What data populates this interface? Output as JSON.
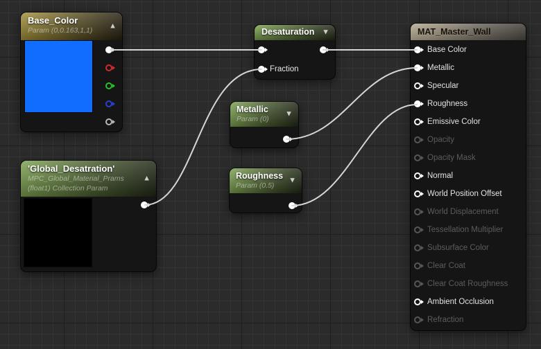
{
  "icons": {
    "collapse_up": "▲",
    "collapse_down": "▼"
  },
  "colors": {
    "background": "#2b2b2b",
    "grid_minor": "#343434",
    "grid_major": "#1f1f1f",
    "node_body": "#151515",
    "wire": "#d6d6d6",
    "header_gold": "#a3913a",
    "header_green": "#7da351",
    "header_tan": "#b7ac94",
    "base_color_swatch": "#0f6dff",
    "global_swatch": "#000000",
    "pin_red": "#d42a2a",
    "pin_green": "#2bbf2b",
    "pin_blue": "#2b3fd4",
    "pin_alpha": "#b9b9b9",
    "pin_white": "#ffffff",
    "disabled_text": "#5c5c5c"
  },
  "nodes": {
    "base_color": {
      "title": "Base_Color",
      "subtitle": "Param (0,0.163,1,1)",
      "swatch_color": "#0f6dff",
      "outputs": [
        "rgb",
        "r",
        "g",
        "b",
        "a"
      ]
    },
    "global_desaturation": {
      "title": "'Global_Desatration'",
      "subtitle": "MPC_Global_Material_Prams (float1) Collection Param",
      "swatch_color": "#000000"
    },
    "desaturation": {
      "title": "Desaturation",
      "fraction_label": "Fraction"
    },
    "metallic": {
      "title": "Metallic",
      "subtitle": "Param (0)"
    },
    "roughness": {
      "title": "Roughness",
      "subtitle": "Param (0.5)"
    },
    "mat_master_wall": {
      "title": "MAT_Master_Wall",
      "inputs": [
        {
          "label": "Base Color",
          "state": "connected"
        },
        {
          "label": "Metallic",
          "state": "connected"
        },
        {
          "label": "Specular",
          "state": "active"
        },
        {
          "label": "Roughness",
          "state": "connected"
        },
        {
          "label": "Emissive Color",
          "state": "active"
        },
        {
          "label": "Opacity",
          "state": "disabled"
        },
        {
          "label": "Opacity Mask",
          "state": "disabled"
        },
        {
          "label": "Normal",
          "state": "active"
        },
        {
          "label": "World Position Offset",
          "state": "active"
        },
        {
          "label": "World Displacement",
          "state": "disabled"
        },
        {
          "label": "Tessellation Multiplier",
          "state": "disabled"
        },
        {
          "label": "Subsurface Color",
          "state": "disabled"
        },
        {
          "label": "Clear Coat",
          "state": "disabled"
        },
        {
          "label": "Clear Coat Roughness",
          "state": "disabled"
        },
        {
          "label": "Ambient Occlusion",
          "state": "active"
        },
        {
          "label": "Refraction",
          "state": "disabled"
        }
      ]
    }
  },
  "wires": [
    {
      "from": "base-color-rgb-output",
      "to": "desaturation-input"
    },
    {
      "from": "desaturation-output",
      "to": "mat-base-color-input"
    },
    {
      "from": "global-desaturation-output",
      "to": "desaturation-fraction-input"
    },
    {
      "from": "metallic-output",
      "to": "mat-metallic-input"
    },
    {
      "from": "roughness-output",
      "to": "mat-roughness-input"
    }
  ]
}
